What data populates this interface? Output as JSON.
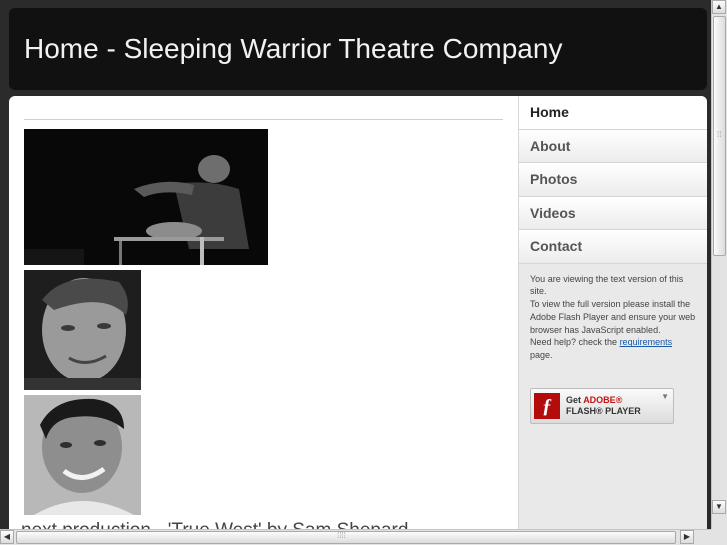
{
  "header": {
    "title": "Home - Sleeping Warrior Theatre Company"
  },
  "main": {
    "photos": [
      "performance-photo",
      "actor-portrait",
      "actor-portrait"
    ],
    "caption": "next production - 'True West' by Sam Shepard"
  },
  "nav": {
    "items": [
      {
        "label": "Home",
        "active": true
      },
      {
        "label": "About"
      },
      {
        "label": "Photos"
      },
      {
        "label": "Videos"
      },
      {
        "label": "Contact"
      }
    ]
  },
  "notice": {
    "line1": "You are viewing the text version of this site.",
    "line2": "To view the full version please install the Adobe Flash Player and ensure your web browser has JavaScript enabled.",
    "line3_prefix": "Need help? check the ",
    "link": "requirements",
    "line3_suffix": " page."
  },
  "flash_button": {
    "get": "Get",
    "adobe": "ADOBE®",
    "player": "FLASH® PLAYER",
    "icon": "flash-icon"
  },
  "colors": {
    "header_bg": "#111111",
    "sidebar_bg": "#e9e9e9",
    "link": "#1a5aa8",
    "adobe_red": "#c41212"
  }
}
